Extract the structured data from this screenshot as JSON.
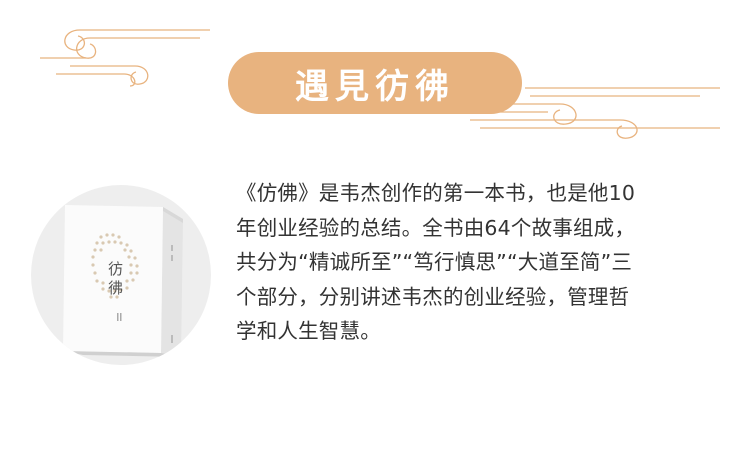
{
  "header": {
    "title": "遇見彷彿"
  },
  "book": {
    "cover_title": "彷彿"
  },
  "description": {
    "lines": [
      "《仿佛》是韦杰创作的第一本书，也是他10",
      "年创业经验的总结。全书由64个故事组成，",
      "共分为“精诚所至”“笃行慎思”“大道至简”三",
      "个部分，分别讲述韦杰的创业经验，管理哲",
      "学和人生智慧。"
    ]
  },
  "colors": {
    "accent": "#e8b37f",
    "text": "#333333",
    "circle_bg": "#eeeeee"
  }
}
